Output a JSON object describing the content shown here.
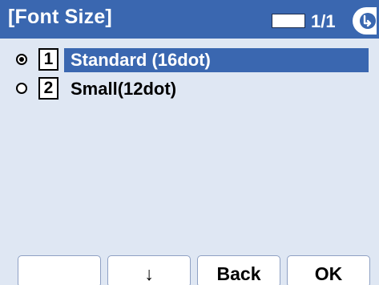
{
  "header": {
    "title": "[Font Size]",
    "page_indicator": "1/1",
    "back_icon": "back-arrow-icon"
  },
  "colors": {
    "header_bg": "#3a67b0",
    "screen_bg": "#dfe7f3",
    "highlight_bg": "#3a67b0"
  },
  "options": [
    {
      "number": "1",
      "label": "Standard (16dot)",
      "selected": true,
      "highlighted": true
    },
    {
      "number": "2",
      "label": "Small(12dot)",
      "selected": false,
      "highlighted": false
    }
  ],
  "softkeys": {
    "key1": "",
    "key2": "↓",
    "key3": "Back",
    "key4": "OK"
  }
}
